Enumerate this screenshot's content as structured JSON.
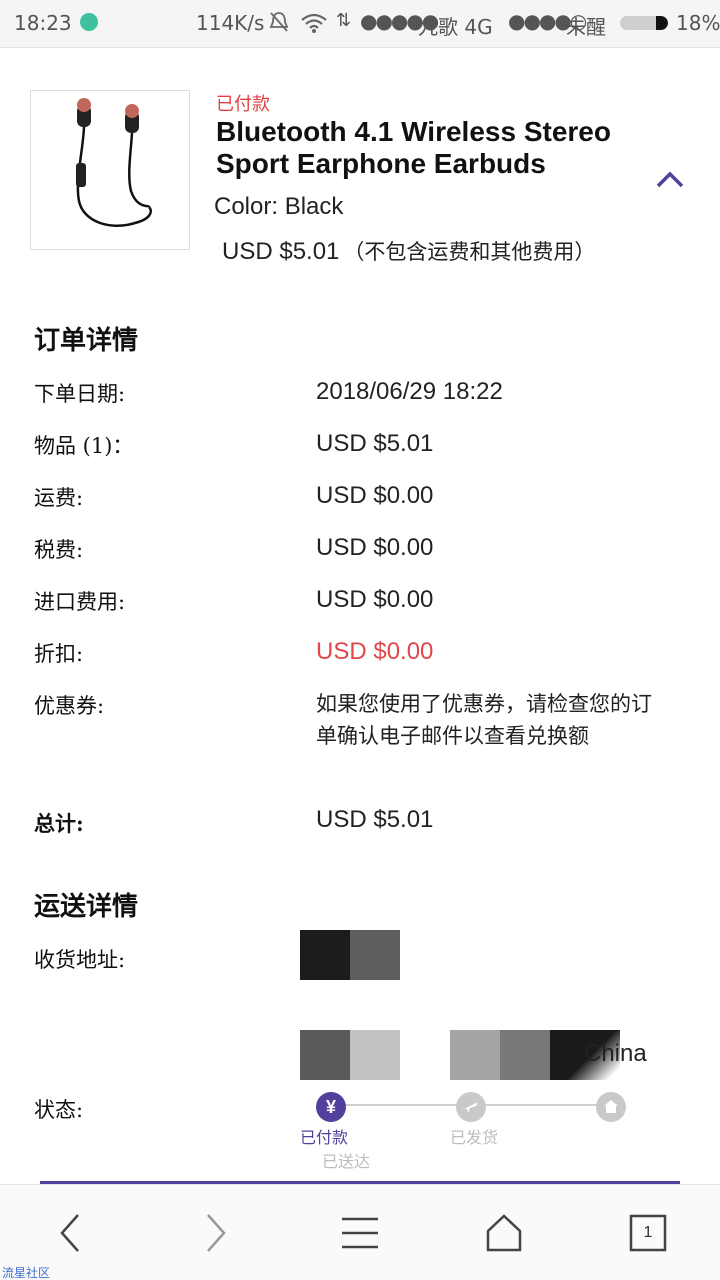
{
  "status_bar": {
    "time": "18:23",
    "speed": "114K/s",
    "signal1": "●●●●●",
    "carrier": "九歌 4G",
    "signal2": "●●●●○",
    "sleep_mode": "未醒",
    "battery": "18%"
  },
  "product": {
    "status_label": "已付款",
    "title": "Bluetooth 4.1 Wireless Stereo Sport Earphone Earbuds",
    "color": "Color: Black",
    "price": "USD $5.01",
    "price_note": "（不包含运费和其他费用）",
    "collapse_icon": "chevron-up-icon"
  },
  "order_details": {
    "title": "订单详情",
    "rows": [
      {
        "label": "下单日期:",
        "value": "2018/06/29 18:22"
      },
      {
        "label": "物品 (1)：",
        "value": "USD $5.01"
      },
      {
        "label": "运费:",
        "value": "USD $0.00"
      },
      {
        "label": "税费:",
        "value": "USD $0.00"
      },
      {
        "label": "进口费用:",
        "value": "USD $0.00"
      },
      {
        "label": "折扣:",
        "value": "USD $0.00"
      },
      {
        "label": "优惠券:",
        "value": "如果您使用了优惠券，请检查您的订单确认电子邮件以查看兑换额"
      },
      {
        "label": "总计:",
        "value": "USD $5.01"
      }
    ],
    "discount_color": "#e0474c"
  },
  "shipping_details": {
    "title": "运送详情",
    "address_label": "收货地址:",
    "country": "China",
    "status_label": "状态:",
    "steps": [
      {
        "label": "已付款",
        "icon": "yen-icon"
      },
      {
        "label": "已发货",
        "icon": "plane-icon"
      },
      {
        "label": "已送达",
        "icon": "home-icon"
      }
    ],
    "accent": "#53409c"
  },
  "bottom_nav": {
    "back_icon": "chevron-left-icon",
    "forward_icon": "chevron-right-icon",
    "menu_icon": "menu-icon",
    "home_icon": "home-icon",
    "tabs_count": "1"
  },
  "watermark": "流星社区"
}
